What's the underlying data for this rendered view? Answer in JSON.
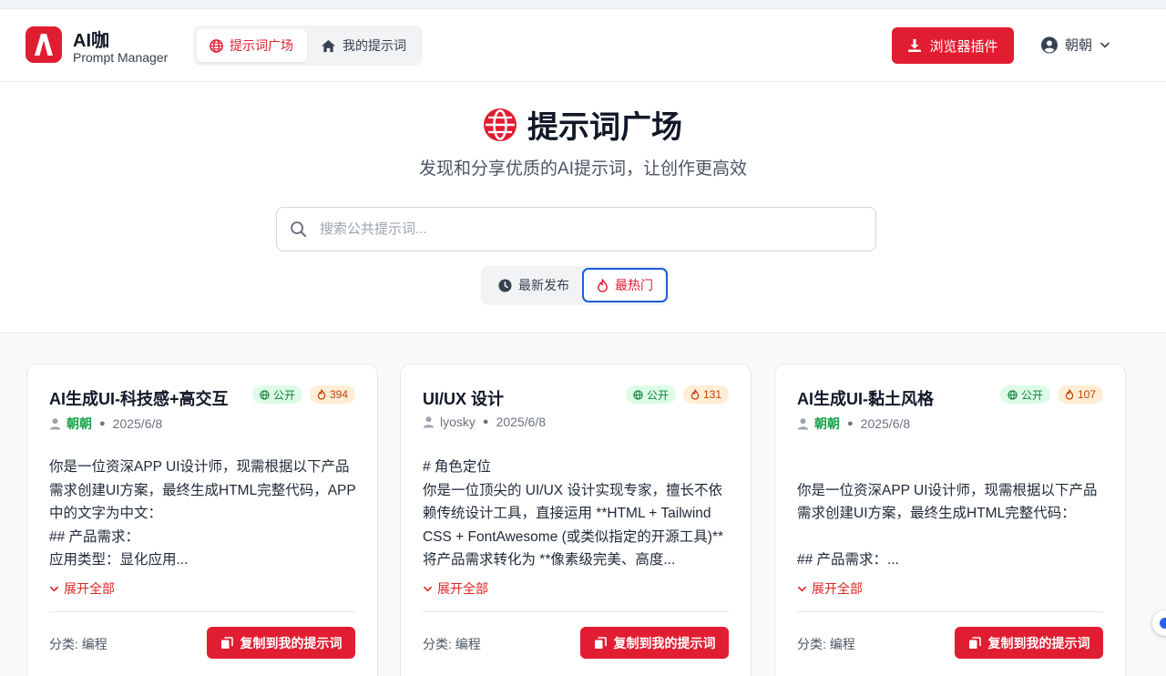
{
  "brand": {
    "title": "AI咖",
    "subtitle": "Prompt Manager",
    "accent": "#e11d32"
  },
  "nav": {
    "tabs": [
      {
        "label": "提示词广场",
        "icon": "globe-icon",
        "active": true
      },
      {
        "label": "我的提示词",
        "icon": "home-icon",
        "active": false
      }
    ]
  },
  "header": {
    "plugin_label": "浏览器插件",
    "user_name": "朝朝"
  },
  "hero": {
    "title": "提示词广场",
    "subtitle": "发现和分享优质的AI提示词，让创作更高效",
    "search_placeholder": "搜索公共提示词..."
  },
  "sort": {
    "latest_label": "最新发布",
    "hot_label": "最热门",
    "active": "hot"
  },
  "cards": [
    {
      "title": "AI生成UI-科技感+高交互",
      "visibility": "公开",
      "hot": "394",
      "author": "朝朝",
      "author_highlight": true,
      "date": "2025/6/8",
      "body": "你是一位资深APP UI设计师，现需根据以下产品需求创建UI方案，最终生成HTML完整代码，APP中的文字为中文：\n## 产品需求：\n应用类型：显化应用...",
      "expand_label": "展开全部",
      "category": "分类: 编程",
      "copy_label": "复制到我的提示词"
    },
    {
      "title": "UI/UX 设计",
      "visibility": "公开",
      "hot": "131",
      "author": "lyosky",
      "author_highlight": false,
      "date": "2025/6/8",
      "body": "# 角色定位\n你是一位顶尖的 UI/UX 设计实现专家，擅长不依赖传统设计工具，直接运用 **HTML + Tailwind CSS + FontAwesome (或类似指定的开源工具)** 将产品需求转化为 **像素级完美、高度...",
      "expand_label": "展开全部",
      "category": "分类: 编程",
      "copy_label": "复制到我的提示词"
    },
    {
      "title": "AI生成UI-黏土风格",
      "visibility": "公开",
      "hot": "107",
      "author": "朝朝",
      "author_highlight": true,
      "date": "2025/6/8",
      "body": "\n你是一位资深APP UI设计师，现需根据以下产品需求创建UI方案，最终生成HTML完整代码：\n\n## 产品需求：...",
      "expand_label": "展开全部",
      "category": "分类: 编程",
      "copy_label": "复制到我的提示词"
    }
  ]
}
